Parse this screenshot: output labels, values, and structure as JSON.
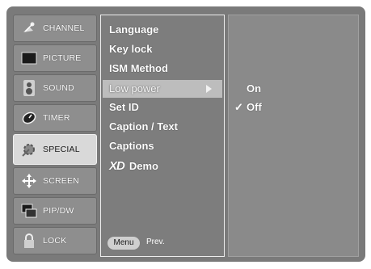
{
  "tabs": [
    {
      "label": "CHANNEL",
      "icon": "satellite-dish-icon",
      "active": false
    },
    {
      "label": "PICTURE",
      "icon": "tv-screen-icon",
      "active": false
    },
    {
      "label": "SOUND",
      "icon": "speaker-icon",
      "active": false
    },
    {
      "label": "TIMER",
      "icon": "clock-icon",
      "active": false
    },
    {
      "label": "SPECIAL",
      "icon": "gear-icon",
      "active": true
    },
    {
      "label": "SCREEN",
      "icon": "move-arrows-icon",
      "active": false
    },
    {
      "label": "PIP/DW",
      "icon": "pip-windows-icon",
      "active": false
    },
    {
      "label": "LOCK",
      "icon": "lock-icon",
      "active": false
    }
  ],
  "submenu": {
    "items": [
      "Language",
      "Key lock",
      "ISM Method",
      "Low power",
      "Set ID",
      "Caption / Text",
      "Captions",
      "Demo"
    ],
    "xd_logo": "XD",
    "menu_button": "Menu",
    "prev_label": "Prev."
  },
  "options": {
    "items": [
      "On",
      "Off"
    ],
    "checkmark": "✓"
  }
}
